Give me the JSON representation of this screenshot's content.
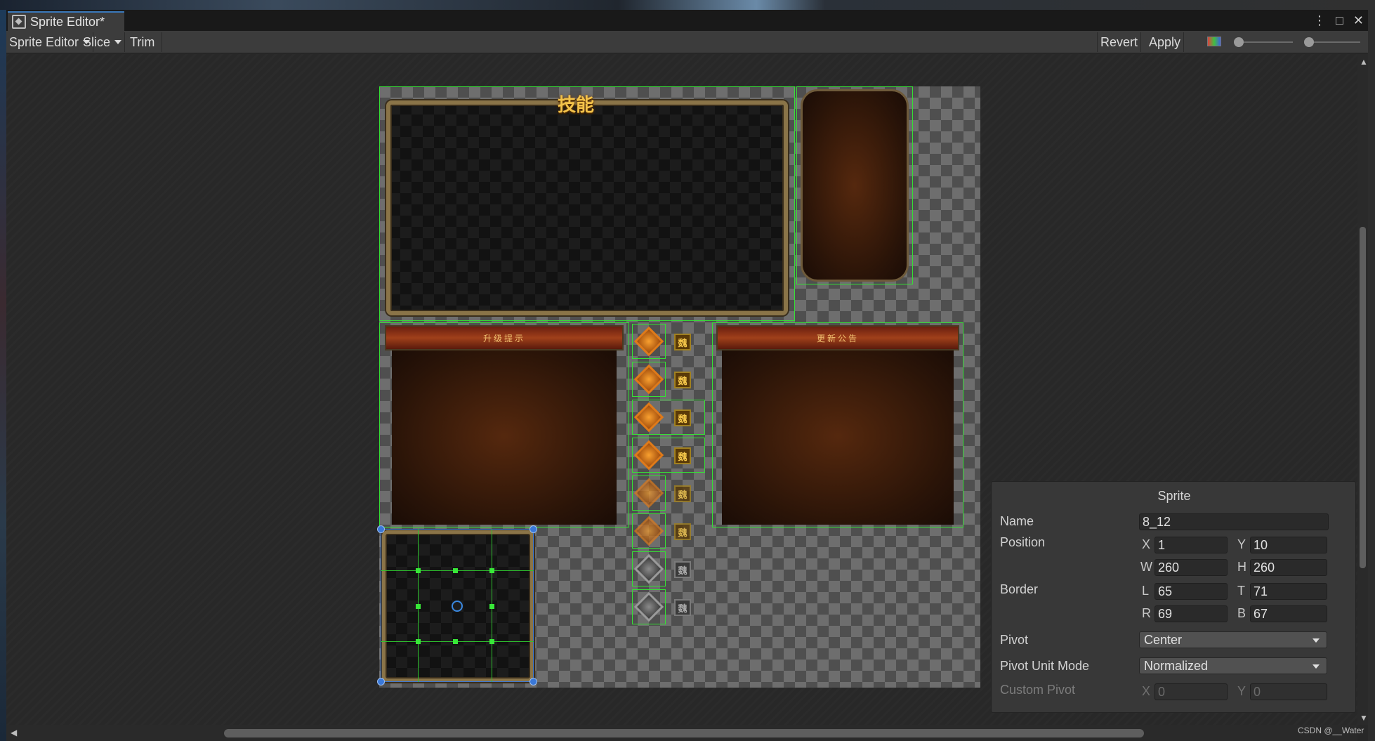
{
  "window": {
    "tab_title": "Sprite Editor*",
    "controls": {
      "more": "⋮",
      "maximize": "□",
      "close": "✕"
    }
  },
  "toolbar": {
    "mode_label": "Sprite Editor",
    "slice_label": "Slice",
    "trim_label": "Trim",
    "revert_label": "Revert",
    "apply_label": "Apply"
  },
  "canvas": {
    "header_text_1": "技能",
    "banner_left": "升级提示",
    "banner_right": "更新公告",
    "icon_glyph": "魏"
  },
  "inspector": {
    "title": "Sprite",
    "name_label": "Name",
    "name_value": "8_12",
    "position_label": "Position",
    "x_label": "X",
    "x_value": "1",
    "y_label": "Y",
    "y_value": "10",
    "w_label": "W",
    "w_value": "260",
    "h_label": "H",
    "h_value": "260",
    "border_label": "Border",
    "l_label": "L",
    "l_value": "65",
    "t_label": "T",
    "t_value": "71",
    "r_label": "R",
    "r_value": "69",
    "b_label": "B",
    "b_value": "67",
    "pivot_label": "Pivot",
    "pivot_value": "Center",
    "pivot_unit_label": "Pivot Unit Mode",
    "pivot_unit_value": "Normalized",
    "custom_pivot_label": "Custom Pivot",
    "cp_x_label": "X",
    "cp_x_value": "0",
    "cp_y_label": "Y",
    "cp_y_value": "0"
  },
  "watermark": "CSDN @__Water",
  "colors": {
    "selection_outline": "#35e035",
    "accent_tab": "#3a79bb",
    "handle_blue": "#3a78d8"
  }
}
